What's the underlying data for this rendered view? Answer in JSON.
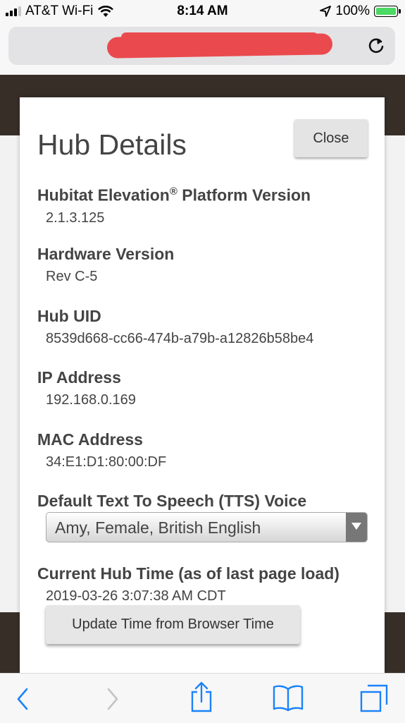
{
  "status_bar": {
    "carrier": "AT&T Wi-Fi",
    "time": "8:14 AM",
    "battery": "100%",
    "icons": [
      "signal-icon",
      "wifi-icon",
      "location-icon",
      "battery-icon"
    ]
  },
  "browser": {
    "url": "",
    "icons": [
      "reload-icon",
      "back-icon",
      "forward-icon",
      "share-icon",
      "bookmarks-icon",
      "tabs-icon"
    ]
  },
  "modal": {
    "title": "Hub Details",
    "close_label": "Close",
    "fields": [
      {
        "label": "Hubitat Elevation",
        "label_sup": "®",
        "label_suffix": " Platform Version",
        "value": "2.1.3.125"
      },
      {
        "label": "Hardware Version",
        "value": "Rev C-5"
      },
      {
        "label": "Hub UID",
        "value": "8539d668-cc66-474b-a79b-a12826b58be4"
      },
      {
        "label": "IP Address",
        "value": "192.168.0.169"
      },
      {
        "label": "MAC Address",
        "value": "34:E1:D1:80:00:DF"
      }
    ],
    "tts": {
      "label": "Default Text To Speech (TTS) Voice",
      "selected": "Amy, Female, British English"
    },
    "hub_time": {
      "label": "Current Hub Time (as of last page load)",
      "value": "2019-03-26 3:07:38 AM CDT",
      "button_label": "Update Time from Browser Time"
    }
  },
  "colors": {
    "accent_dark": "#382e28",
    "redaction": "#ea4a4e",
    "ios_blue": "#1a82fb",
    "battery_green": "#4cd964"
  }
}
